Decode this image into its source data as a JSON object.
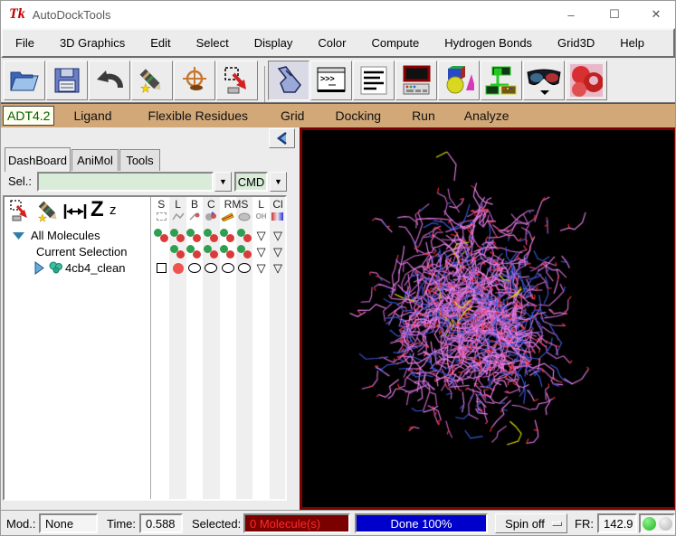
{
  "window": {
    "title": "AutoDockTools",
    "icon": "Tk",
    "minimize": "–",
    "maximize": "☐",
    "close": "✕"
  },
  "menu": {
    "items": [
      "File",
      "3D Graphics",
      "Edit",
      "Select",
      "Display",
      "Color",
      "Compute",
      "Hydrogen Bonds",
      "Grid3D",
      "Help"
    ]
  },
  "toolbar": {
    "icons": [
      "open-file",
      "save-session",
      "undo",
      "edit-pencil",
      "center-target",
      "select-from-box",
      "hand-pick",
      "python-shell",
      "log-window",
      "keyboard-monitor",
      "geometry-shapes",
      "tree-widget",
      "stereo-glasses",
      "surface-display"
    ],
    "shell_icon_text": ">>>"
  },
  "workflow_tabs": {
    "items": [
      "ADT4.2",
      "Ligand",
      "Flexible Residues",
      "Grid",
      "Docking",
      "Run",
      "Analyze"
    ],
    "active": "ADT4.2",
    "bar_color": "#d2a878",
    "active_text_color": "#005f00"
  },
  "dashboard": {
    "tabs": [
      "DashBoard",
      "AniMol",
      "Tools"
    ],
    "active_tab": "DashBoard",
    "sel_label": "Sel.:",
    "sel_value": "",
    "cmd_label": "CMD",
    "zoom_big": "Z",
    "zoom_small": "z"
  },
  "tree": {
    "header_letters": [
      "S",
      "L",
      "B",
      "C",
      "RMS",
      "L",
      "Cl"
    ],
    "header_spans": [
      1,
      1,
      1,
      1,
      2,
      1,
      1
    ],
    "column_icons": [
      "marquee-icon",
      "lines-icon",
      "sticks-icon",
      "balls-icon",
      "ribbon-icon",
      "surface-icon",
      "oh-label-icon",
      "colorscale-icon"
    ],
    "oh_label": "OH",
    "rows": [
      {
        "label": "All Molecules",
        "expander": "down",
        "icon": null,
        "cells": [
          "pair",
          "pair",
          "pair",
          "pair",
          "pair",
          "pair",
          "tri",
          "tri"
        ]
      },
      {
        "label": "Current Selection",
        "expander": "none",
        "icon": null,
        "cells": [
          "empty",
          "pair",
          "pair",
          "pair",
          "pair",
          "pair",
          "tri",
          "tri"
        ]
      },
      {
        "label": "4cb4_clean",
        "expander": "right",
        "icon": "molecule-icon",
        "cells": [
          "square",
          "dot",
          "oval",
          "oval",
          "oval",
          "oval",
          "tri",
          "tri"
        ]
      }
    ]
  },
  "viewer": {
    "background": "#000000",
    "border_color": "#7b0000",
    "molecule": "4cb4_clean",
    "render_mode": "lines",
    "colors": {
      "carbon": "#ee82ee",
      "carbon2": "#d970d9",
      "carbon3": "#c866c8",
      "core": "#9a55a0",
      "nitrogen": "#3b5bdb",
      "oxygen": "#ff3030",
      "sulfur": "#e3e300"
    }
  },
  "statusbar": {
    "mod_label": "Mod.:",
    "mod_value": "None",
    "time_label": "Time:",
    "time_value": "0.588",
    "selected_label": "Selected:",
    "selected_value": "0 Molecule(s)",
    "progress_text": "Done 100%",
    "progress_percent": 100,
    "spin_label": "Spin off",
    "fr_label": "FR:",
    "fr_value": "142.9",
    "leds": [
      "green",
      "gray"
    ]
  }
}
